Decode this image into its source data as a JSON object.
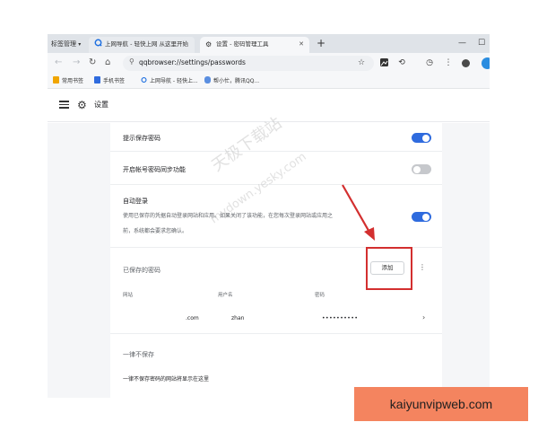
{
  "colors": {
    "accent": "#2f6bde",
    "toggle_off": "#c6c8cc",
    "annotation_red": "#d32f2f",
    "banner_bg": "#f4845f"
  },
  "browser": {
    "tab_group_label": "标签管理",
    "tabs": [
      {
        "label": "上网导航 - 轻快上网 从这里开始",
        "icon": "qq-browser-icon"
      },
      {
        "label": "设置 - 密码管理工具",
        "icon": "gear-icon"
      }
    ],
    "new_tab_label": "+",
    "address": "qqbrowser://settings/passwords",
    "bookmarks": [
      {
        "label": "常用书签",
        "icon": "bookmark-icon"
      },
      {
        "label": "手机书签",
        "icon": "bookmark-icon"
      },
      {
        "label": "上网导航 - 轻快上...",
        "icon": "qq-browser-icon"
      },
      {
        "label": "帮小忙，腾讯QQ...",
        "icon": "cloud-icon"
      }
    ]
  },
  "settings": {
    "title": "设置",
    "offer_save_label": "提示保存密码",
    "offer_save_on": true,
    "sync_label": "开启帐号密码同步功能",
    "sync_on": false,
    "autologin_label": "自动登录",
    "autologin_desc_line1": "使用已保存的凭据自动登录网站和应用。如果关闭了该功能，在您每次登录网站或应用之",
    "autologin_desc_line2": "前，系统都会要求您确认。",
    "autologin_on": true,
    "saved_passwords_label": "已保存的密码",
    "add_label": "添加",
    "columns": {
      "site": "网站",
      "username": "用户名",
      "password": "密码"
    },
    "entries": [
      {
        "site": ".com",
        "username": "zhan",
        "password": "••••••••••"
      }
    ],
    "never_saved_label": "一律不保存",
    "never_saved_desc": "一律不保存密码的网站将显示在这里"
  },
  "watermark": {
    "line1": "天极下载站",
    "line2": "mydown.yesky.com"
  },
  "banner": {
    "text": "kaiyunvipweb.com"
  }
}
